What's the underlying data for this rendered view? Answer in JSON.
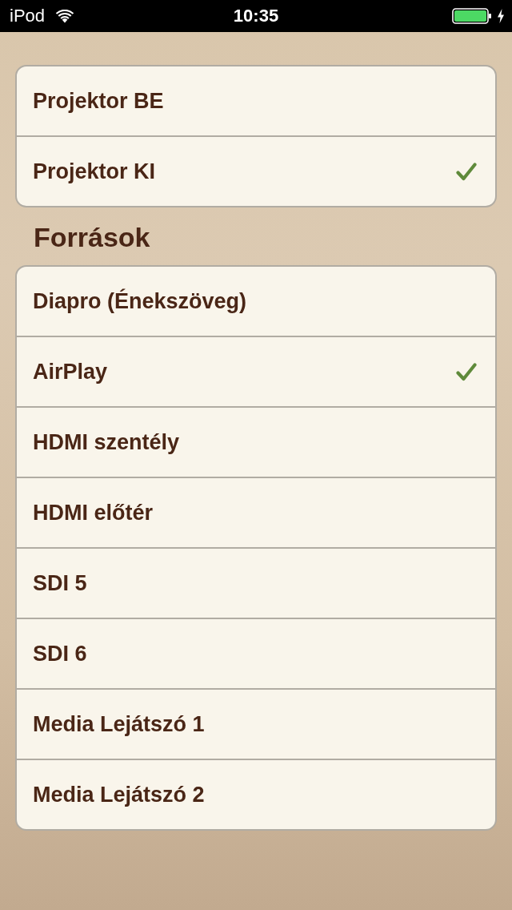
{
  "status_bar": {
    "carrier": "iPod",
    "time": "10:35",
    "charging": true
  },
  "sections": [
    {
      "rows": [
        {
          "label": "Projektor BE",
          "selected": false
        },
        {
          "label": "Projektor KI",
          "selected": true
        }
      ]
    },
    {
      "header": "Források",
      "rows": [
        {
          "label": "Diapro (Énekszöveg)",
          "selected": false
        },
        {
          "label": "AirPlay",
          "selected": true
        },
        {
          "label": "HDMI szentély",
          "selected": false
        },
        {
          "label": "HDMI előtér",
          "selected": false
        },
        {
          "label": "SDI 5",
          "selected": false
        },
        {
          "label": "SDI 6",
          "selected": false
        },
        {
          "label": "Media Lejátszó 1",
          "selected": false
        },
        {
          "label": "Media Lejátszó 2",
          "selected": false
        }
      ]
    }
  ]
}
